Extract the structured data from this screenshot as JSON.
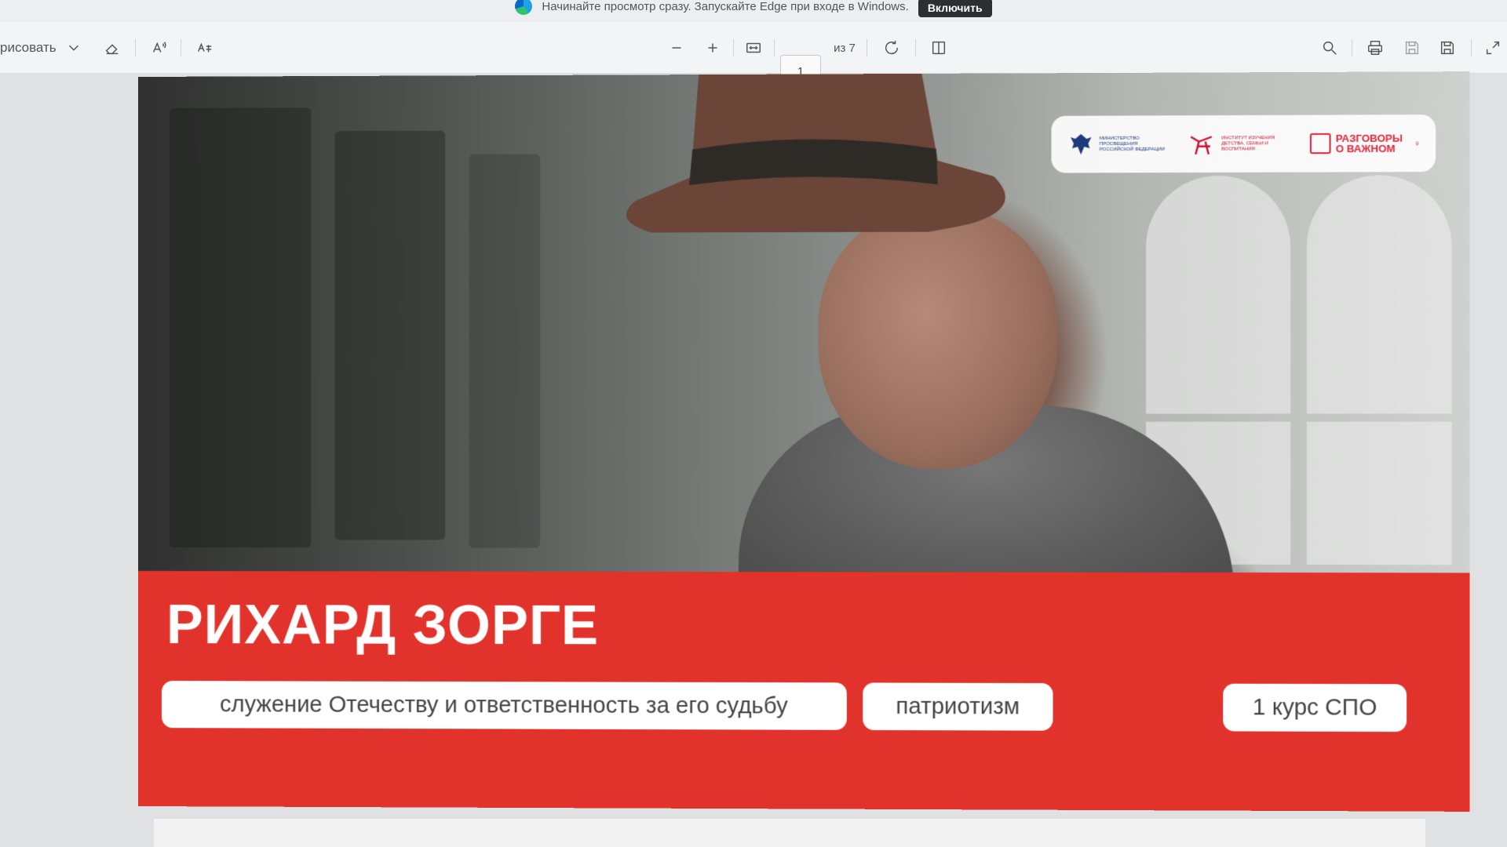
{
  "notification": {
    "message": "Начинайте просмотр сразу. Запускайте Edge при входе в Windows.",
    "enable_label": "Включить"
  },
  "toolbar": {
    "draw_label": "рисовать",
    "page_current": "1",
    "page_total": "из 7"
  },
  "document": {
    "title": "РИХАРД ЗОРГЕ",
    "tag_service": "служение Отечеству и ответственность за его судьбу",
    "tag_patriotism": "патриотизм",
    "course": "1 курс СПО",
    "logos": {
      "ministry": "МИНИСТЕРСТВО ПРОСВЕЩЕНИЯ РОССИЙСКОЙ ФЕДЕРАЦИИ",
      "institute": "институт изучения детства, семьи и воспитания",
      "razgovory": "РАЗГОВОРЫ О ВАЖНОМ"
    }
  },
  "colors": {
    "banner": "#e1322b",
    "pill_bg": "#ffffff",
    "title_text": "#ffffff"
  }
}
